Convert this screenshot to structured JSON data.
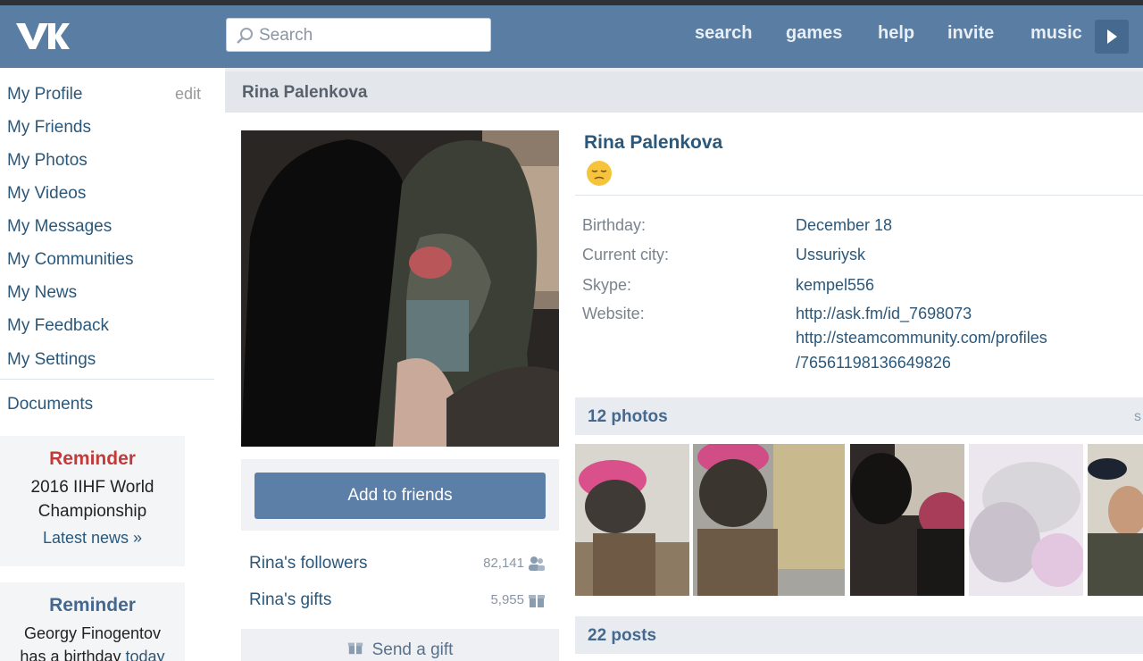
{
  "header": {
    "search_placeholder": "Search",
    "nav": [
      "search",
      "games",
      "help",
      "invite",
      "music"
    ]
  },
  "sidebar": {
    "items": [
      {
        "label": "My Profile"
      },
      {
        "label": "My Friends"
      },
      {
        "label": "My Photos"
      },
      {
        "label": "My Videos"
      },
      {
        "label": "My Messages"
      },
      {
        "label": "My Communities"
      },
      {
        "label": "My News"
      },
      {
        "label": "My Feedback"
      },
      {
        "label": "My Settings"
      }
    ],
    "edit_label": "edit",
    "documents_label": "Documents",
    "reminders": [
      {
        "title": "Reminder",
        "line1": "2016 IIHF World",
        "line2": "Championship",
        "link": "Latest news »"
      },
      {
        "title": "Reminder",
        "line1": "Georgy Finogentov",
        "line2_prefix": "has a birthday",
        "line2_link": "today"
      }
    ]
  },
  "profile": {
    "page_title": "Rina Palenkova",
    "name": "Rina Palenkova",
    "status_icon": "pensive-face-emoji",
    "add_friends_label": "Add to friends",
    "followers_label": "Rina's followers",
    "followers_count": "82,141",
    "gifts_label": "Rina's gifts",
    "gifts_count": "5,955",
    "send_gift_label": "Send a gift",
    "info": {
      "birthday_label": "Birthday:",
      "birthday": "December 18",
      "city_label": "Current city:",
      "city": "Ussuriysk",
      "skype_label": "Skype:",
      "skype": "kempel556",
      "website_label": "Website:",
      "website1": "http://ask.fm/id_7698073",
      "website2a": "http://steamcommunity.com/profiles",
      "website2b": "/76561198136649826"
    },
    "photos_label": "12 photos",
    "photos_more": "s",
    "posts_label": "22 posts"
  },
  "colors": {
    "header_bg": "#597da3",
    "link": "#2b587a",
    "reminder_red": "#c33a3a",
    "button_bg": "#5b7fa6"
  }
}
